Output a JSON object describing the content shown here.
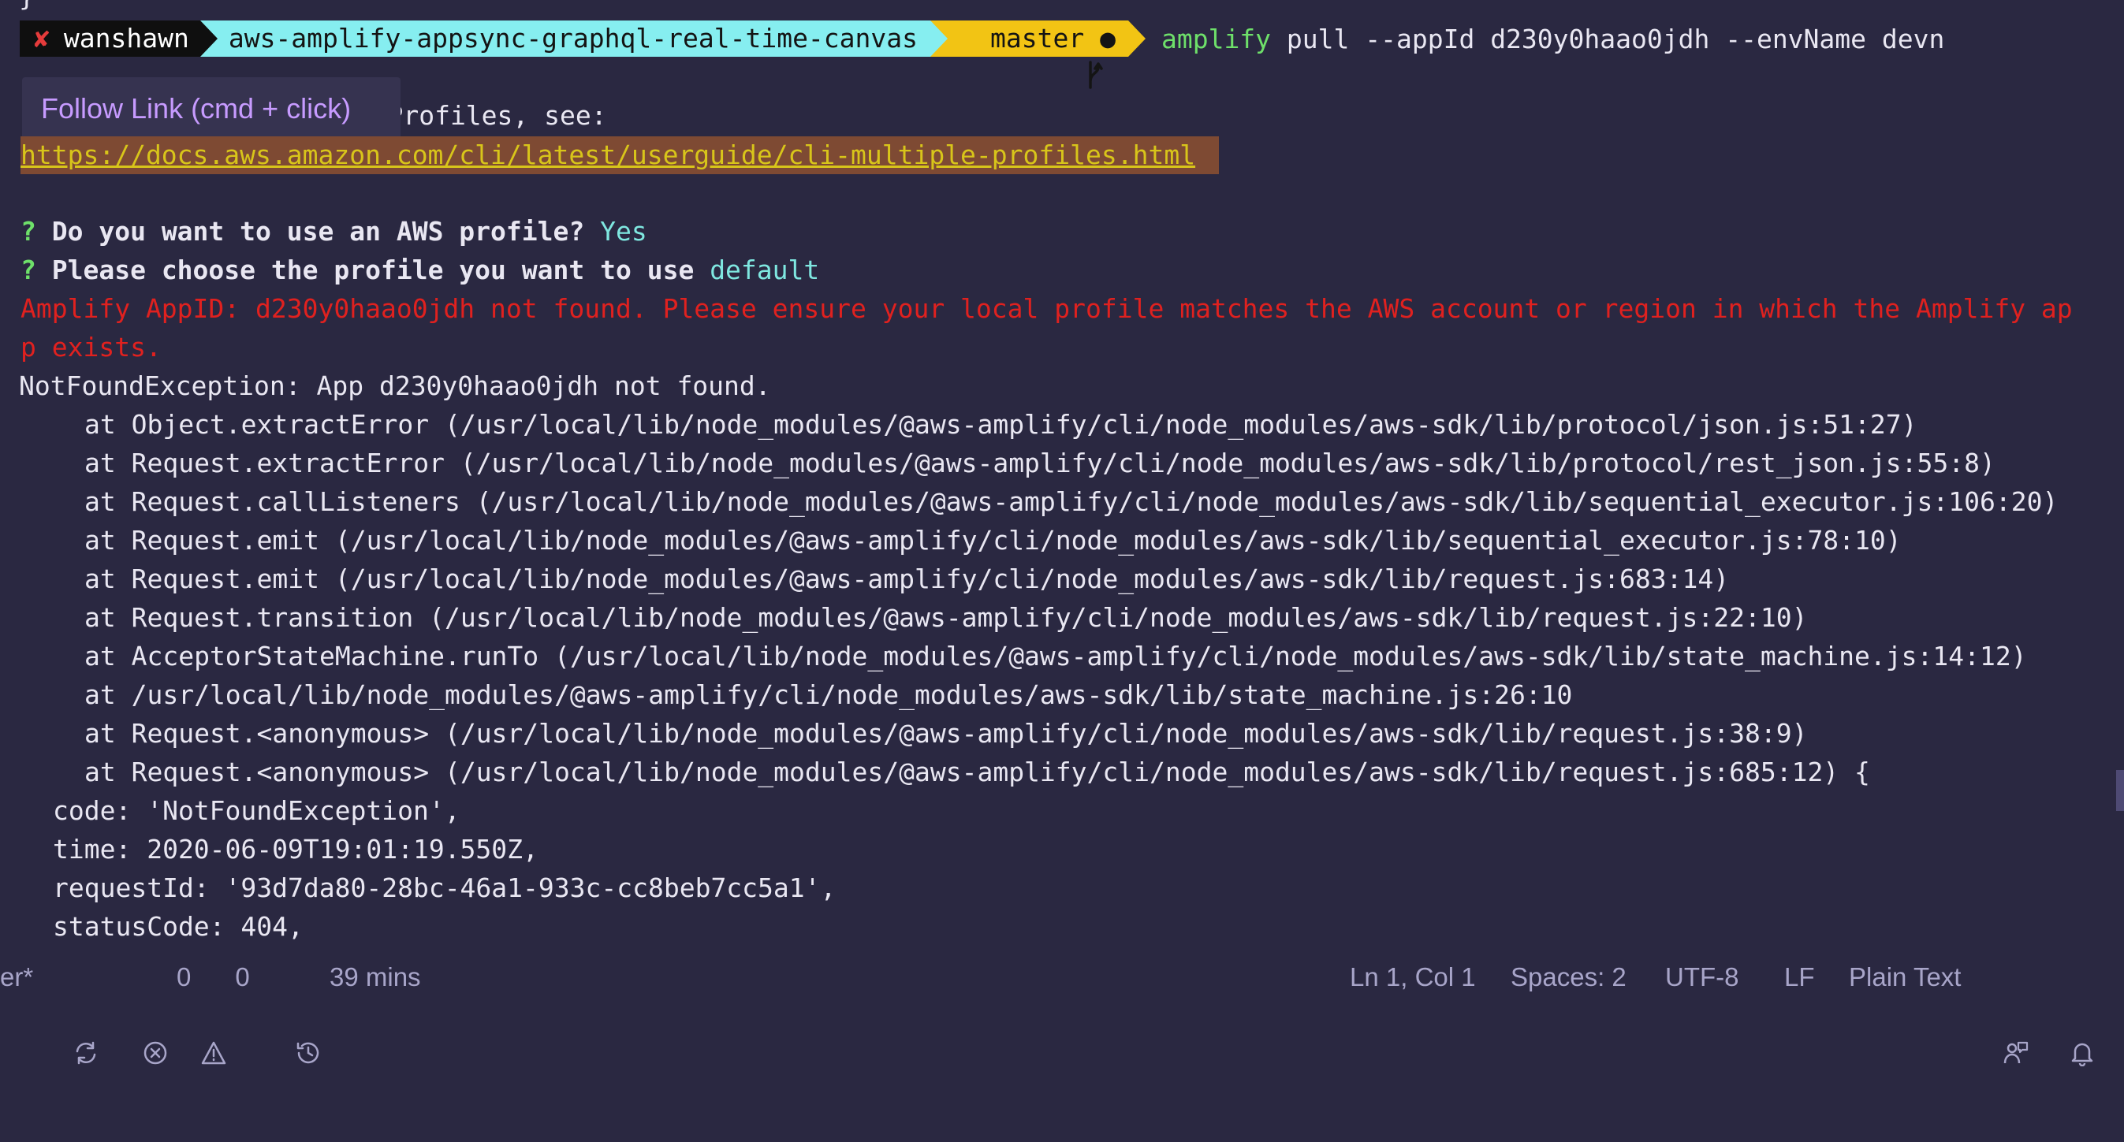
{
  "terminal": {
    "top_curly": "}",
    "prompt": {
      "status_mark": "✘",
      "user": "wanshawn",
      "directory": "aws-amplify-appsync-graphql-real-time-canvas",
      "git_branch_icon": "git-branch-icon",
      "git_branch": "master ●",
      "command_name": "amplify",
      "command_args": " pull --appId d230y0haao0jdh --envName devn"
    },
    "tooltip": {
      "text": "Follow Link (cmd + click)"
    },
    "line_profiles_tail": "AWS Profiles, see:",
    "link": "https://docs.aws.amazon.com/cli/latest/userguide/cli-multiple-profiles.html",
    "q1": {
      "mark": "?",
      "question": " Do you want to use an AWS profile? ",
      "answer": "Yes"
    },
    "q2": {
      "mark": "?",
      "question": " Please choose the profile you want to use ",
      "answer": "default"
    },
    "error_line_1": "Amplify AppID: d230y0haao0jdh not found. Please ensure your local profile matches the AWS account or region in which the Amplify ap",
    "error_line_2": "p exists.",
    "exception": "NotFoundException: App d230y0haao0jdh not found.",
    "stack": [
      "at Object.extractError (/usr/local/lib/node_modules/@aws-amplify/cli/node_modules/aws-sdk/lib/protocol/json.js:51:27)",
      "at Request.extractError (/usr/local/lib/node_modules/@aws-amplify/cli/node_modules/aws-sdk/lib/protocol/rest_json.js:55:8)",
      "at Request.callListeners (/usr/local/lib/node_modules/@aws-amplify/cli/node_modules/aws-sdk/lib/sequential_executor.js:106:20)",
      "at Request.emit (/usr/local/lib/node_modules/@aws-amplify/cli/node_modules/aws-sdk/lib/sequential_executor.js:78:10)",
      "at Request.emit (/usr/local/lib/node_modules/@aws-amplify/cli/node_modules/aws-sdk/lib/request.js:683:14)",
      "at Request.transition (/usr/local/lib/node_modules/@aws-amplify/cli/node_modules/aws-sdk/lib/request.js:22:10)",
      "at AcceptorStateMachine.runTo (/usr/local/lib/node_modules/@aws-amplify/cli/node_modules/aws-sdk/lib/state_machine.js:14:12)",
      "at /usr/local/lib/node_modules/@aws-amplify/cli/node_modules/aws-sdk/lib/state_machine.js:26:10",
      "at Request.<anonymous> (/usr/local/lib/node_modules/@aws-amplify/cli/node_modules/aws-sdk/lib/request.js:38:9)",
      "at Request.<anonymous> (/usr/local/lib/node_modules/@aws-amplify/cli/node_modules/aws-sdk/lib/request.js:685:12) {"
    ],
    "props": [
      "code: 'NotFoundException',",
      "time: 2020-06-09T19:01:19.550Z,",
      "requestId: '93d7da80-28bc-46a1-933c-cc8beb7cc5a1',",
      "statusCode: 404,"
    ]
  },
  "statusbar": {
    "branch_fragment": "er*",
    "errors": "0",
    "warnings": "0",
    "time_ago": "39 mins",
    "cursor": "Ln 1, Col 1",
    "spaces": "Spaces: 2",
    "encoding": "UTF-8",
    "eol": "LF",
    "language": "Plain Text"
  },
  "colors": {
    "background": "#2a2841",
    "error_red": "#e0211f",
    "prompt_green": "#6ee06a",
    "answer_cyan": "#7fe7e0",
    "tooltip_purple": "#c79bff",
    "link_yellow": "#d8c51a",
    "link_highlight": "#7e4a33"
  }
}
